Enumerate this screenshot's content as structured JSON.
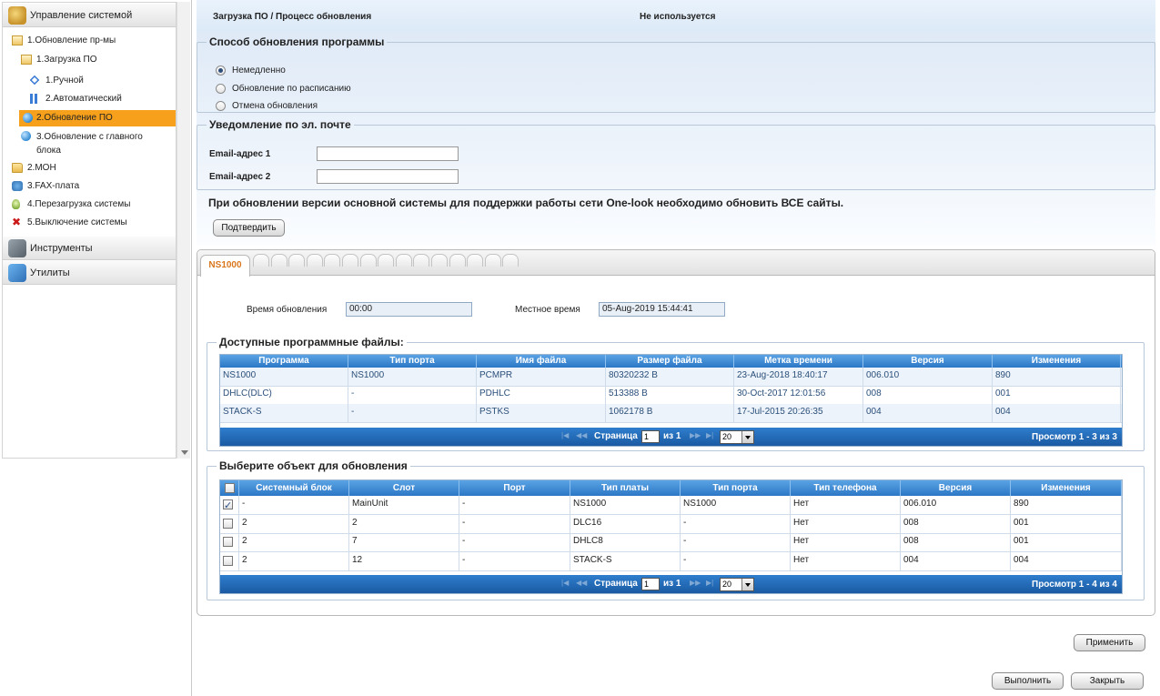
{
  "sidebar": {
    "sections": [
      {
        "label": "Управление системой",
        "icon": "system-gear-icon"
      },
      {
        "label": "Инструменты",
        "icon": "tools-icon"
      },
      {
        "label": "Утилиты",
        "icon": "box-icon"
      }
    ],
    "tree": [
      {
        "label": "1.Обновление пр-мы",
        "icon": "folder-open-icon"
      },
      {
        "label": "1.Загрузка ПО",
        "icon": "folder-open-icon"
      },
      {
        "label": "1.Ручной",
        "icon": "diamond-icon"
      },
      {
        "label": "2.Автоматический",
        "icon": "arrows-icon"
      },
      {
        "label": "2.Обновление ПО",
        "icon": "globe-icon",
        "selected": true
      },
      {
        "label": "3.Обновление с главного блока",
        "icon": "globe-icon"
      },
      {
        "label": "2.MOH",
        "icon": "folder-icon"
      },
      {
        "label": "3.FAX-плата",
        "icon": "fax-icon"
      },
      {
        "label": "4.Перезагрузка системы",
        "icon": "bulb-icon"
      },
      {
        "label": "5.Выключение системы",
        "icon": "x-icon"
      }
    ]
  },
  "header": {
    "breadcrumb": "Загрузка ПО / Процесс обновления",
    "status": "Не используется"
  },
  "update_method": {
    "legend": "Способ обновления программы",
    "options": [
      "Немедленно",
      "Обновление по расписанию",
      "Отмена обновления"
    ],
    "selected": 0
  },
  "email": {
    "legend": "Уведомление по эл. почте",
    "label1": "Email-адрес 1",
    "label2": "Email-адрес 2",
    "value1": "",
    "value2": ""
  },
  "notice": "При обновлении версии основной системы для поддержки работы сети One-look необходимо обновить ВСЕ сайты.",
  "confirm_label": "Подтвердить",
  "tabs": {
    "active": "NS1000",
    "empty_count": 15
  },
  "times": {
    "update_label": "Время обновления",
    "update_value": "00:00",
    "local_label": "Местное время",
    "local_value": "05-Aug-2019 15:44:41"
  },
  "files": {
    "legend": "Доступные программные файлы:",
    "columns": [
      "Программа",
      "Тип порта",
      "Имя файла",
      "Размер файла",
      "Метка времени",
      "Версия",
      "Изменения"
    ],
    "rows": [
      [
        "NS1000",
        "NS1000",
        "PCMPR",
        "80320232 B",
        "23-Aug-2018 18:40:17",
        "006.010",
        "890"
      ],
      [
        "DHLC(DLC)",
        "-",
        "PDHLC",
        "513388 B",
        "30-Oct-2017 12:01:56",
        "008",
        "001"
      ],
      [
        "STACK-S",
        "-",
        "PSTKS",
        "1062178 B",
        "17-Jul-2015 20:26:35",
        "004",
        "004"
      ]
    ],
    "pager": {
      "page_label": "Страница",
      "page": "1",
      "of_label": "из 1",
      "page_size": "20",
      "view": "Просмотр 1 - 3 из 3"
    }
  },
  "targets": {
    "legend": "Выберите объект для обновления",
    "columns": [
      "Системный блок",
      "Слот",
      "Порт",
      "Тип платы",
      "Тип порта",
      "Тип телефона",
      "Версия",
      "Изменения"
    ],
    "rows": [
      {
        "checked": true,
        "cells": [
          "-",
          "MainUnit",
          "-",
          "NS1000",
          "NS1000",
          "Нет",
          "006.010",
          "890"
        ]
      },
      {
        "checked": false,
        "cells": [
          "2",
          "2",
          "-",
          "DLC16",
          "-",
          "Нет",
          "008",
          "001"
        ]
      },
      {
        "checked": false,
        "cells": [
          "2",
          "7",
          "-",
          "DHLC8",
          "-",
          "Нет",
          "008",
          "001"
        ]
      },
      {
        "checked": false,
        "cells": [
          "2",
          "12",
          "-",
          "STACK-S",
          "-",
          "Нет",
          "004",
          "004"
        ]
      }
    ],
    "pager": {
      "page_label": "Страница",
      "page": "1",
      "of_label": "из 1",
      "page_size": "20",
      "view": "Просмотр 1 - 4 из 4"
    }
  },
  "buttons": {
    "apply": "Применить",
    "execute": "Выполнить",
    "close": "Закрыть"
  },
  "colors": {
    "selected_item": "#f7a01b",
    "grid_header": "#2c77c6",
    "active_tab_text": "#d9761b"
  }
}
